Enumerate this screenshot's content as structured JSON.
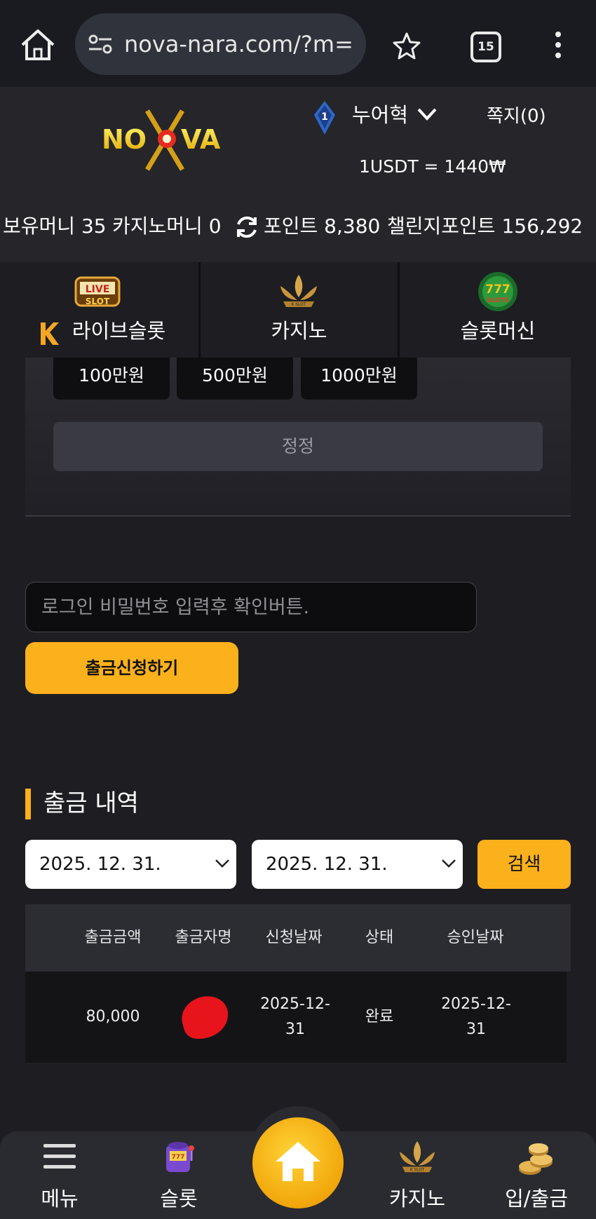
{
  "browser": {
    "url": "nova-nara.com/?m=",
    "tab_count": "15",
    "icons": [
      "home-icon",
      "site-settings-icon",
      "star-icon",
      "more-vert-icon"
    ]
  },
  "header": {
    "logo_text": "NOVA",
    "username": "누어혁",
    "messages": "쪽지(0)",
    "rate": "1USDT = 1440₩",
    "rank_level": "1"
  },
  "balance": {
    "money": "보유머니 35",
    "casino_money": "카지노머니 0",
    "points": "포인트 8,380",
    "challenge_points": "챌린지포인트 156,292"
  },
  "categories": [
    {
      "label": "라이브슬롯",
      "icon": "live-slot-icon"
    },
    {
      "label": "카지노",
      "icon": "k-slot-icon"
    },
    {
      "label": "슬롯머신",
      "icon": "777-slots-icon"
    }
  ],
  "amounts": [
    "100만원",
    "500만원",
    "1000만원"
  ],
  "reset_label": "정정",
  "password_placeholder": "로그인 비밀번호 입력후 확인버튼.",
  "withdraw_button": "출금신청하기",
  "history": {
    "title": "출금 내역",
    "date_from": "2025. 12. 31.",
    "date_to": "2025. 12. 31.",
    "search_label": "검색",
    "columns": [
      "출금금액",
      "출금자명",
      "신청날짜",
      "상태",
      "승인날짜"
    ],
    "rows": [
      {
        "amount": "80,000",
        "name": "",
        "requested": "2025-12-31",
        "status": "완료",
        "approved": "2025-12-31"
      }
    ]
  },
  "bottom_nav": [
    {
      "label": "메뉴",
      "icon": "menu-icon"
    },
    {
      "label": "슬롯",
      "icon": "slot-machine-icon"
    },
    {
      "label": "",
      "icon": "home-icon"
    },
    {
      "label": "카지노",
      "icon": "k-slot-icon"
    },
    {
      "label": "입/출금",
      "icon": "coins-icon"
    }
  ],
  "colors": {
    "accent": "#fbb11c",
    "background": "#1e1e22",
    "header": "#25252a"
  }
}
